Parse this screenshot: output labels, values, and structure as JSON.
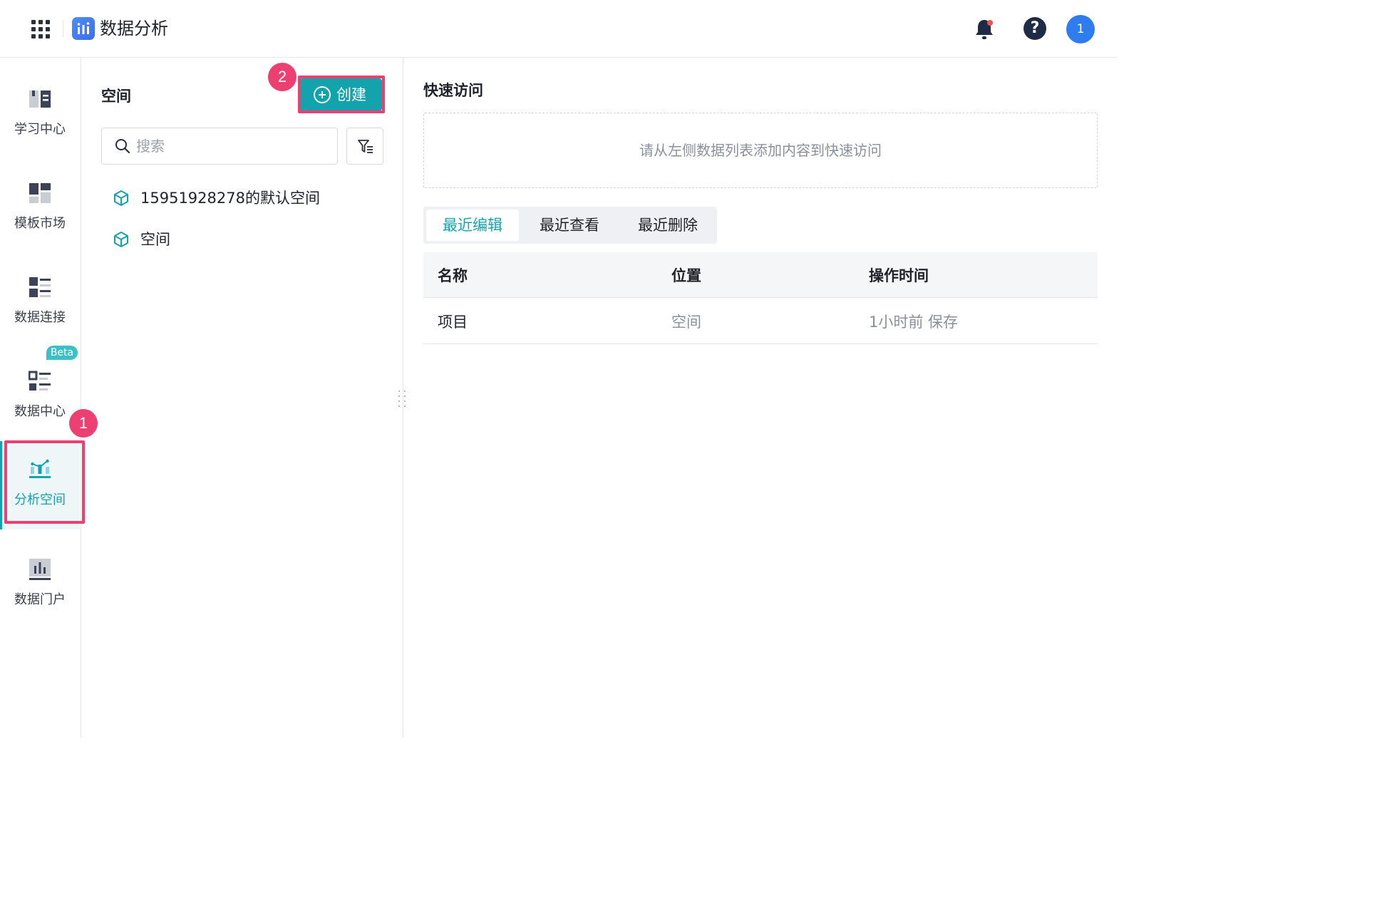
{
  "header": {
    "app_title": "数据分析",
    "apps_icon": "grid-icon",
    "notification_icon": "bell-icon",
    "notification_dot_color": "#f0534e",
    "help_icon": "question-icon",
    "help_symbol": "?",
    "avatar_text": "1"
  },
  "sidebar": {
    "items": [
      {
        "label": "学习中心",
        "icon": "book-icon"
      },
      {
        "label": "模板市场",
        "icon": "template-icon"
      },
      {
        "label": "数据连接",
        "icon": "data-connection-icon"
      },
      {
        "label": "数据中心",
        "icon": "data-center-icon",
        "badge": "Beta"
      },
      {
        "label": "分析空间",
        "icon": "analysis-space-icon",
        "active": true
      },
      {
        "label": "数据门户",
        "icon": "data-portal-icon"
      }
    ]
  },
  "spaces_panel": {
    "title": "空间",
    "create_label": "创建",
    "search_placeholder": "搜索",
    "filter_icon": "filter-icon",
    "items": [
      {
        "label": "15951928278的默认空间",
        "icon": "cube-icon"
      },
      {
        "label": "空间",
        "icon": "cube-icon"
      }
    ]
  },
  "main": {
    "quick_access_title": "快速访问",
    "quick_access_hint": "请从左侧数据列表添加内容到快速访问",
    "tabs": [
      {
        "label": "最近编辑",
        "active": true
      },
      {
        "label": "最近查看",
        "active": false
      },
      {
        "label": "最近删除",
        "active": false
      }
    ],
    "table": {
      "columns": [
        "名称",
        "位置",
        "操作时间"
      ],
      "rows": [
        {
          "name": "项目",
          "location": "空间",
          "time": "1小时前 保存"
        }
      ]
    }
  },
  "annotations": {
    "marker_1": "1",
    "marker_2": "2",
    "color": "#ec3f72"
  },
  "colors": {
    "accent": "#13a3ad",
    "text": "#1f2329",
    "muted_text": "#8a909b"
  }
}
